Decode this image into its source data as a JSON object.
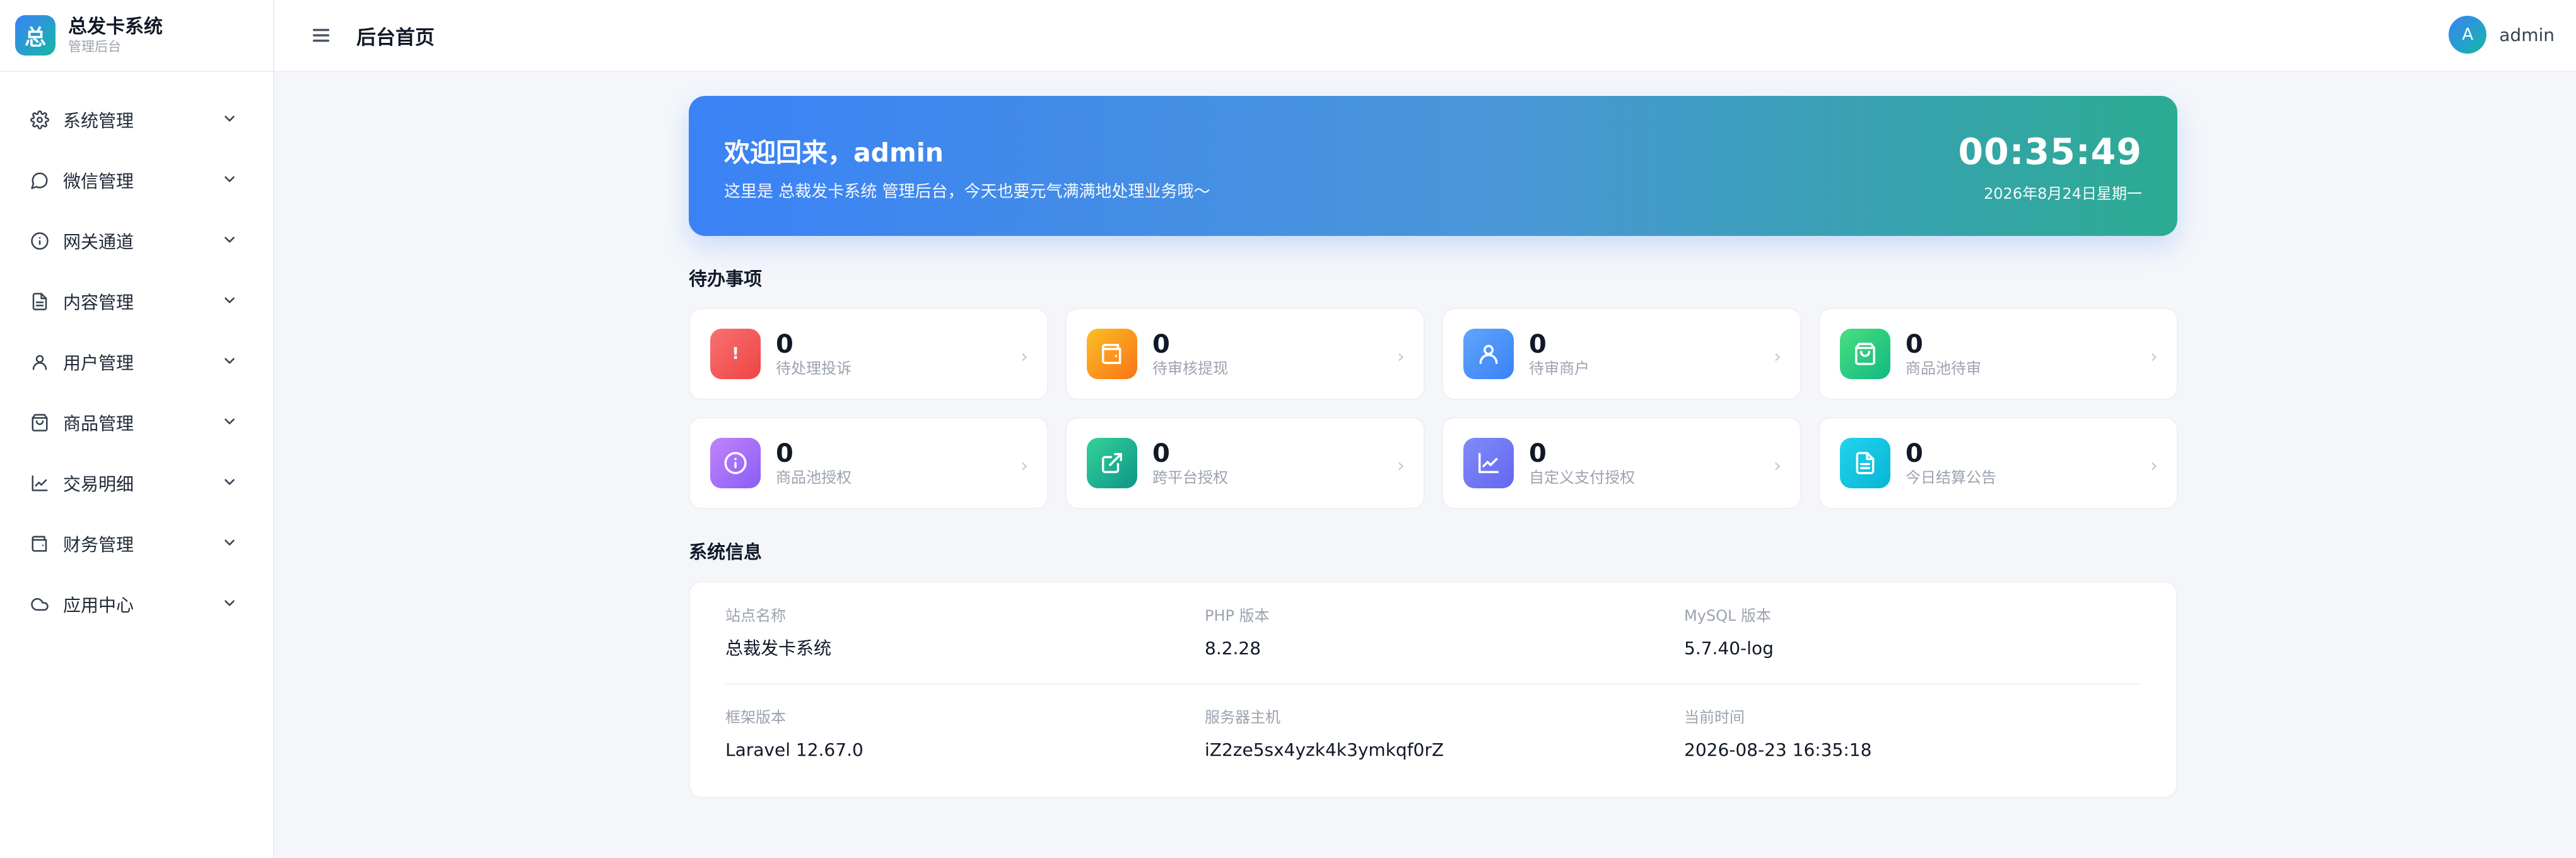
{
  "brand": {
    "logo_char": "总",
    "title": "总发卡系统",
    "subtitle": "管理后台"
  },
  "sidebar": {
    "items": [
      {
        "label": "系统管理",
        "icon": "gear-icon"
      },
      {
        "label": "微信管理",
        "icon": "chat-icon"
      },
      {
        "label": "网关通道",
        "icon": "info-icon"
      },
      {
        "label": "内容管理",
        "icon": "document-icon"
      },
      {
        "label": "用户管理",
        "icon": "user-icon"
      },
      {
        "label": "商品管理",
        "icon": "shopping-bag-icon"
      },
      {
        "label": "交易明细",
        "icon": "line-chart-icon"
      },
      {
        "label": "财务管理",
        "icon": "wallet-icon"
      },
      {
        "label": "应用中心",
        "icon": "cloud-icon"
      }
    ]
  },
  "topbar": {
    "page_title": "后台首页",
    "user_initial": "A",
    "user_name": "admin"
  },
  "hero": {
    "title": "欢迎回来，admin",
    "subtitle": "这里是 总裁发卡系统 管理后台，今天也要元气满满地处理业务哦～",
    "time": "00:35:49",
    "date": "2026年8月24日星期一"
  },
  "todo": {
    "title": "待办事项",
    "items": [
      {
        "count": "0",
        "label": "待处理投诉",
        "icon": "alert-icon",
        "color": "#ef4444"
      },
      {
        "count": "0",
        "label": "待审核提现",
        "icon": "wallet-icon",
        "color": "#f59e0b"
      },
      {
        "count": "0",
        "label": "待审商户",
        "icon": "user-icon",
        "color": "#3b82f6"
      },
      {
        "count": "0",
        "label": "商品池待审",
        "icon": "shopping-bag-icon",
        "color": "#22c55e"
      },
      {
        "count": "0",
        "label": "商品池授权",
        "icon": "info-icon",
        "color": "#a855f7"
      },
      {
        "count": "0",
        "label": "跨平台授权",
        "icon": "external-link-icon",
        "color": "#10b981"
      },
      {
        "count": "0",
        "label": "自定义支付授权",
        "icon": "line-chart-icon",
        "color": "#6366f1"
      },
      {
        "count": "0",
        "label": "今日结算公告",
        "icon": "document-icon",
        "color": "#06b6d4"
      }
    ]
  },
  "sysinfo": {
    "title": "系统信息",
    "rows": [
      [
        {
          "key": "站点名称",
          "value": "总裁发卡系统"
        },
        {
          "key": "PHP 版本",
          "value": "8.2.28"
        },
        {
          "key": "MySQL 版本",
          "value": "5.7.40-log"
        }
      ],
      [
        {
          "key": "框架版本",
          "value": "Laravel 12.67.0"
        },
        {
          "key": "服务器主机",
          "value": "iZ2ze5sx4yzk4k3ymkqf0rZ"
        },
        {
          "key": "当前时间",
          "value": "2026-08-23 16:35:18"
        }
      ]
    ]
  }
}
